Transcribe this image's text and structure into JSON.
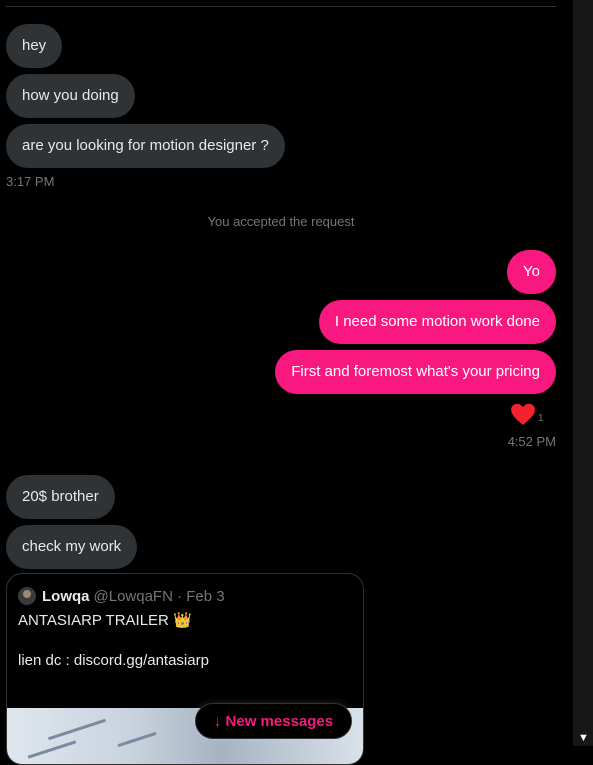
{
  "messages_in_1": [
    {
      "text": "hey"
    },
    {
      "text": "how you doing"
    },
    {
      "text": "are you looking for motion designer ?"
    }
  ],
  "timestamp_1": "3:17 PM",
  "system_notice": "You accepted the request",
  "messages_out": [
    {
      "text": "Yo"
    },
    {
      "text": "I need some motion work done"
    },
    {
      "text": "First and foremost what's your pricing"
    }
  ],
  "reaction": {
    "icon": "heart-icon",
    "count": "1",
    "color": "#f4212e"
  },
  "timestamp_2": "4:52 PM",
  "messages_in_2": [
    {
      "text": "20$ brother"
    },
    {
      "text": "check my work"
    }
  ],
  "shared_post": {
    "author": "Lowqa",
    "handle": "@LowqaFN · Feb 3",
    "text_line1": "ANTASIARP TRAILER",
    "emoji": "👑",
    "text_line2": "lien dc : discord.gg/antasiarp"
  },
  "new_messages_button": "↓ New messages",
  "colors": {
    "accent": "#f91880",
    "bubble_in": "#2f3336",
    "background": "#000000"
  }
}
